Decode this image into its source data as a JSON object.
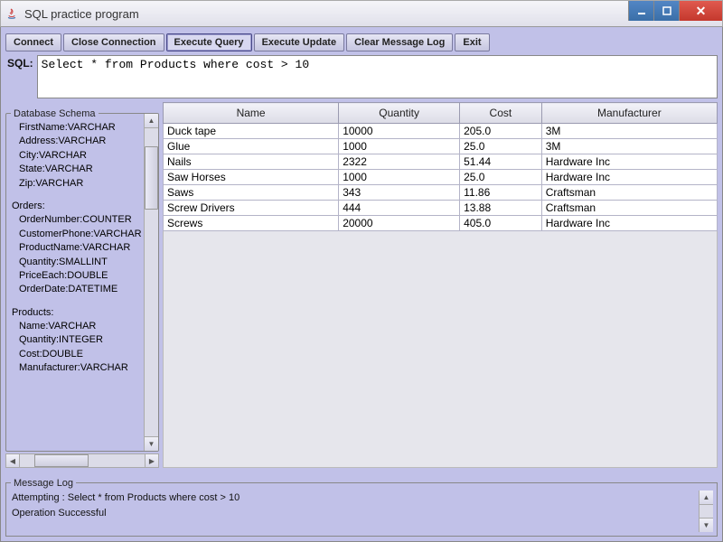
{
  "window": {
    "title": "SQL practice program"
  },
  "toolbar": {
    "connect": "Connect",
    "close_conn": "Close Connection",
    "execute_query": "Execute Query",
    "execute_update": "Execute Update",
    "clear_log": "Clear Message Log",
    "exit": "Exit"
  },
  "sql": {
    "label": "SQL:",
    "value": "Select * from Products where cost > 10"
  },
  "schema": {
    "title": "Database Schema",
    "fields_top": [
      "FirstName:VARCHAR",
      "Address:VARCHAR",
      "City:VARCHAR",
      "State:VARCHAR",
      "Zip:VARCHAR"
    ],
    "orders_title": "Orders:",
    "orders": [
      "OrderNumber:COUNTER",
      "CustomerPhone:VARCHAR",
      "ProductName:VARCHAR",
      "Quantity:SMALLINT",
      "PriceEach:DOUBLE",
      "OrderDate:DATETIME"
    ],
    "products_title": "Products:",
    "products": [
      "Name:VARCHAR",
      "Quantity:INTEGER",
      "Cost:DOUBLE",
      "Manufacturer:VARCHAR"
    ]
  },
  "table": {
    "headers": [
      "Name",
      "Quantity",
      "Cost",
      "Manufacturer"
    ],
    "rows": [
      [
        "Duck tape",
        "10000",
        "205.0",
        "3M"
      ],
      [
        "Glue",
        "1000",
        "25.0",
        "3M"
      ],
      [
        "Nails",
        "2322",
        "51.44",
        "Hardware Inc"
      ],
      [
        "Saw Horses",
        "1000",
        "25.0",
        "Hardware Inc"
      ],
      [
        "Saws",
        "343",
        "11.86",
        "Craftsman"
      ],
      [
        "Screw Drivers",
        "444",
        "13.88",
        "Craftsman"
      ],
      [
        "Screws",
        "20000",
        "405.0",
        "Hardware Inc"
      ]
    ]
  },
  "log": {
    "title": "Message Log",
    "line1": "Attempting : Select * from Products where cost > 10",
    "line2": "Operation Successful"
  }
}
